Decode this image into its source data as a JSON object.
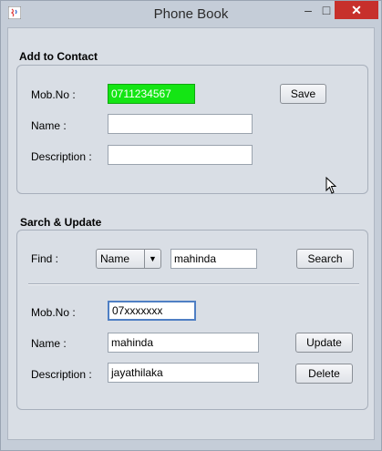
{
  "window": {
    "title": "Phone Book",
    "minimize": "–",
    "maximize": "□",
    "close": "✕"
  },
  "add_contact": {
    "heading": "Add to Contact",
    "mob_label": "Mob.No :",
    "mob_value": "0711234567",
    "name_label": "Name :",
    "name_value": "",
    "desc_label": "Description :",
    "desc_value": "",
    "save_label": "Save"
  },
  "search_update": {
    "heading": "Sarch & Update",
    "find_label": "Find :",
    "find_selected": "Name",
    "find_value": "mahinda",
    "search_label": "Search",
    "mob_label": "Mob.No :",
    "mob_value": "07xxxxxxx",
    "name_label": "Name :",
    "name_value": "mahinda",
    "desc_label": "Description :",
    "desc_value": "jayathilaka",
    "update_label": "Update",
    "delete_label": "Delete"
  },
  "colors": {
    "mob_highlight": "#14e514",
    "close_button": "#c7302b"
  },
  "icons": {
    "app": "java-cup-icon",
    "cursor": "mouse-pointer-icon"
  }
}
